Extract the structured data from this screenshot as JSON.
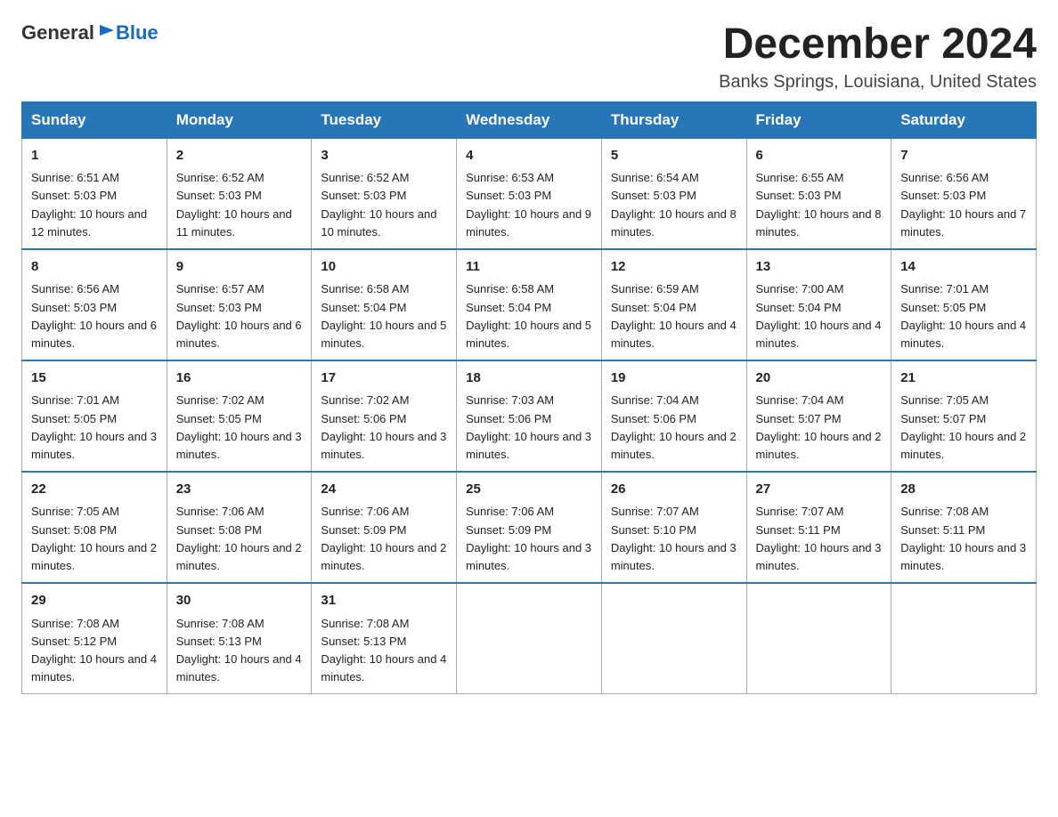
{
  "logo": {
    "general": "General",
    "blue": "Blue"
  },
  "header": {
    "month": "December 2024",
    "location": "Banks Springs, Louisiana, United States"
  },
  "weekdays": [
    "Sunday",
    "Monday",
    "Tuesday",
    "Wednesday",
    "Thursday",
    "Friday",
    "Saturday"
  ],
  "weeks": [
    [
      {
        "day": "1",
        "sunrise": "6:51 AM",
        "sunset": "5:03 PM",
        "daylight": "10 hours and 12 minutes."
      },
      {
        "day": "2",
        "sunrise": "6:52 AM",
        "sunset": "5:03 PM",
        "daylight": "10 hours and 11 minutes."
      },
      {
        "day": "3",
        "sunrise": "6:52 AM",
        "sunset": "5:03 PM",
        "daylight": "10 hours and 10 minutes."
      },
      {
        "day": "4",
        "sunrise": "6:53 AM",
        "sunset": "5:03 PM",
        "daylight": "10 hours and 9 minutes."
      },
      {
        "day": "5",
        "sunrise": "6:54 AM",
        "sunset": "5:03 PM",
        "daylight": "10 hours and 8 minutes."
      },
      {
        "day": "6",
        "sunrise": "6:55 AM",
        "sunset": "5:03 PM",
        "daylight": "10 hours and 8 minutes."
      },
      {
        "day": "7",
        "sunrise": "6:56 AM",
        "sunset": "5:03 PM",
        "daylight": "10 hours and 7 minutes."
      }
    ],
    [
      {
        "day": "8",
        "sunrise": "6:56 AM",
        "sunset": "5:03 PM",
        "daylight": "10 hours and 6 minutes."
      },
      {
        "day": "9",
        "sunrise": "6:57 AM",
        "sunset": "5:03 PM",
        "daylight": "10 hours and 6 minutes."
      },
      {
        "day": "10",
        "sunrise": "6:58 AM",
        "sunset": "5:04 PM",
        "daylight": "10 hours and 5 minutes."
      },
      {
        "day": "11",
        "sunrise": "6:58 AM",
        "sunset": "5:04 PM",
        "daylight": "10 hours and 5 minutes."
      },
      {
        "day": "12",
        "sunrise": "6:59 AM",
        "sunset": "5:04 PM",
        "daylight": "10 hours and 4 minutes."
      },
      {
        "day": "13",
        "sunrise": "7:00 AM",
        "sunset": "5:04 PM",
        "daylight": "10 hours and 4 minutes."
      },
      {
        "day": "14",
        "sunrise": "7:01 AM",
        "sunset": "5:05 PM",
        "daylight": "10 hours and 4 minutes."
      }
    ],
    [
      {
        "day": "15",
        "sunrise": "7:01 AM",
        "sunset": "5:05 PM",
        "daylight": "10 hours and 3 minutes."
      },
      {
        "day": "16",
        "sunrise": "7:02 AM",
        "sunset": "5:05 PM",
        "daylight": "10 hours and 3 minutes."
      },
      {
        "day": "17",
        "sunrise": "7:02 AM",
        "sunset": "5:06 PM",
        "daylight": "10 hours and 3 minutes."
      },
      {
        "day": "18",
        "sunrise": "7:03 AM",
        "sunset": "5:06 PM",
        "daylight": "10 hours and 3 minutes."
      },
      {
        "day": "19",
        "sunrise": "7:04 AM",
        "sunset": "5:06 PM",
        "daylight": "10 hours and 2 minutes."
      },
      {
        "day": "20",
        "sunrise": "7:04 AM",
        "sunset": "5:07 PM",
        "daylight": "10 hours and 2 minutes."
      },
      {
        "day": "21",
        "sunrise": "7:05 AM",
        "sunset": "5:07 PM",
        "daylight": "10 hours and 2 minutes."
      }
    ],
    [
      {
        "day": "22",
        "sunrise": "7:05 AM",
        "sunset": "5:08 PM",
        "daylight": "10 hours and 2 minutes."
      },
      {
        "day": "23",
        "sunrise": "7:06 AM",
        "sunset": "5:08 PM",
        "daylight": "10 hours and 2 minutes."
      },
      {
        "day": "24",
        "sunrise": "7:06 AM",
        "sunset": "5:09 PM",
        "daylight": "10 hours and 2 minutes."
      },
      {
        "day": "25",
        "sunrise": "7:06 AM",
        "sunset": "5:09 PM",
        "daylight": "10 hours and 3 minutes."
      },
      {
        "day": "26",
        "sunrise": "7:07 AM",
        "sunset": "5:10 PM",
        "daylight": "10 hours and 3 minutes."
      },
      {
        "day": "27",
        "sunrise": "7:07 AM",
        "sunset": "5:11 PM",
        "daylight": "10 hours and 3 minutes."
      },
      {
        "day": "28",
        "sunrise": "7:08 AM",
        "sunset": "5:11 PM",
        "daylight": "10 hours and 3 minutes."
      }
    ],
    [
      {
        "day": "29",
        "sunrise": "7:08 AM",
        "sunset": "5:12 PM",
        "daylight": "10 hours and 4 minutes."
      },
      {
        "day": "30",
        "sunrise": "7:08 AM",
        "sunset": "5:13 PM",
        "daylight": "10 hours and 4 minutes."
      },
      {
        "day": "31",
        "sunrise": "7:08 AM",
        "sunset": "5:13 PM",
        "daylight": "10 hours and 4 minutes."
      },
      null,
      null,
      null,
      null
    ]
  ]
}
